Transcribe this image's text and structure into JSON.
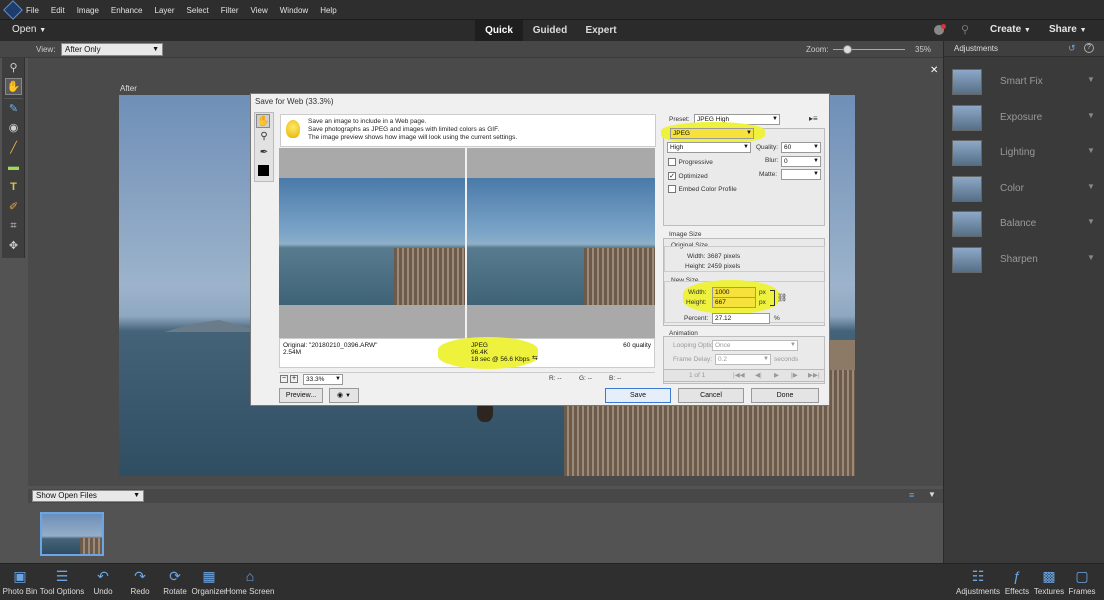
{
  "menu": [
    "File",
    "Edit",
    "Image",
    "Enhance",
    "Layer",
    "Select",
    "Filter",
    "View",
    "Window",
    "Help"
  ],
  "modebar": {
    "open": "Open",
    "tabs": [
      "Quick",
      "Guided",
      "Expert"
    ],
    "create": "Create",
    "share": "Share"
  },
  "options": {
    "view_label": "View:",
    "view_value": "After Only",
    "zoom_label": "Zoom:",
    "zoom_value": "35%",
    "zoom_fraction": 0.35
  },
  "canvas": {
    "label": "After"
  },
  "adjustments": {
    "title": "Adjustments",
    "items": [
      "Smart Fix",
      "Exposure",
      "Lighting",
      "Color",
      "Balance",
      "Sharpen"
    ]
  },
  "filmstrip": {
    "dropdown": "Show Open Files"
  },
  "bottombar": [
    "Photo Bin",
    "Tool Options",
    "Undo",
    "Redo",
    "Rotate",
    "Organizer",
    "Home Screen",
    "Adjustments",
    "Effects",
    "Textures",
    "Frames"
  ],
  "dialog": {
    "title": "Save for Web (33.3%)",
    "tip": [
      "Save an image to include in a Web page.",
      "Save photographs as JPEG and images with limited colors as GIF.",
      "The image preview shows how image will look using the current settings."
    ],
    "original_info": [
      "Original: \"20180210_0396.ARW\"",
      "2.54M"
    ],
    "optimized_info": [
      "JPEG",
      "96.4K",
      "18 sec @ 56.6 Kbps"
    ],
    "quality_info": "60 quality",
    "zoom_value": "33.3%",
    "rgb": {
      "r": "R: --",
      "g": "G: --",
      "b": "B: --"
    },
    "preset_label": "Preset:",
    "preset_value": "JPEG High",
    "format_value": "JPEG",
    "quality_preset": "High",
    "quality_label": "Quality:",
    "quality_value": "60",
    "blur_label": "Blur:",
    "blur_value": "0",
    "matte_label": "Matte:",
    "progressive": "Progressive",
    "optimized": "Optimized",
    "embed_profile": "Embed Color Profile",
    "image_size_label": "Image Size",
    "original_size_label": "Original Size",
    "orig_width": "Width:  3687 pixels",
    "orig_height": "Height:  2459 pixels",
    "new_size_label": "New Size",
    "width_label": "Width:",
    "width_value": "1000",
    "height_label": "Height:",
    "height_value": "667",
    "unit": "px",
    "percent_label": "Percent:",
    "percent_value": "27.12",
    "percent_unit": "%",
    "animation_label": "Animation",
    "looping_label": "Looping Options:",
    "looping_value": "Once",
    "frame_delay_label": "Frame Delay:",
    "frame_delay_value": "0.2",
    "seconds": "seconds",
    "frame_counter": "1 of 1",
    "preview_button": "Preview...",
    "save_button": "Save",
    "cancel_button": "Cancel",
    "done_button": "Done"
  }
}
